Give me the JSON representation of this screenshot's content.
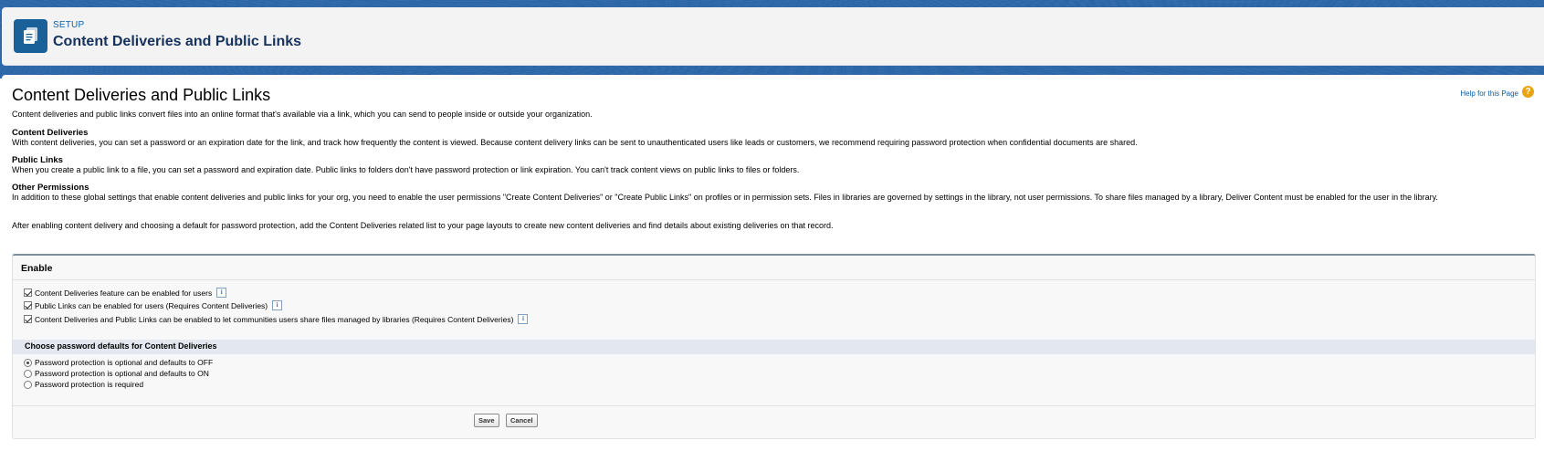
{
  "header": {
    "setup_label": "SETUP",
    "title": "Content Deliveries and Public Links"
  },
  "page": {
    "title": "Content Deliveries and Public Links",
    "help_link": "Help for this Page",
    "help_icon": "?",
    "intro": "Content deliveries and public links convert files into an online format that's available via a link, which you can send to people inside or outside your organization.",
    "sections": [
      {
        "title": "Content Deliveries",
        "text": "With content deliveries, you can set a password or an expiration date for the link, and track how frequently the content is viewed. Because content delivery links can be sent to unauthenticated users like leads or customers, we recommend requiring password protection when confidential documents are shared."
      },
      {
        "title": "Public Links",
        "text": "When you create a public link to a file, you can set a password and expiration date. Public links to folders don't have password protection or link expiration. You can't track content views on public links to files or folders."
      },
      {
        "title": "Other Permissions",
        "text": "In addition to these global settings that enable content deliveries and public links for your org, you need to enable the user permissions \"Create Content Deliveries\" or \"Create Public Links\" on profiles or in permission sets. Files in libraries are governed by settings in the library, not user permissions. To share files managed by a library, Deliver Content must be enabled for the user in the library."
      }
    ],
    "after_text": "After enabling content delivery and choosing a default for password protection, add the Content Deliveries related list to your page layouts to create new content deliveries and find details about existing deliveries on that record."
  },
  "enable": {
    "title": "Enable",
    "checkboxes": [
      {
        "label": "Content Deliveries feature can be enabled for users",
        "checked": true
      },
      {
        "label": "Public Links can be enabled for users (Requires Content Deliveries)",
        "checked": true
      },
      {
        "label": "Content Deliveries and Public Links can be enabled to let communities users share files managed by libraries (Requires Content Deliveries)",
        "checked": true
      }
    ],
    "info_glyph": "i",
    "password_section_title": "Choose password defaults for Content Deliveries",
    "radios": [
      {
        "label": "Password protection is optional and defaults to OFF",
        "selected": true
      },
      {
        "label": "Password protection is optional and defaults to ON",
        "selected": false
      },
      {
        "label": "Password protection is required",
        "selected": false
      }
    ],
    "save_label": "Save",
    "cancel_label": "Cancel"
  }
}
